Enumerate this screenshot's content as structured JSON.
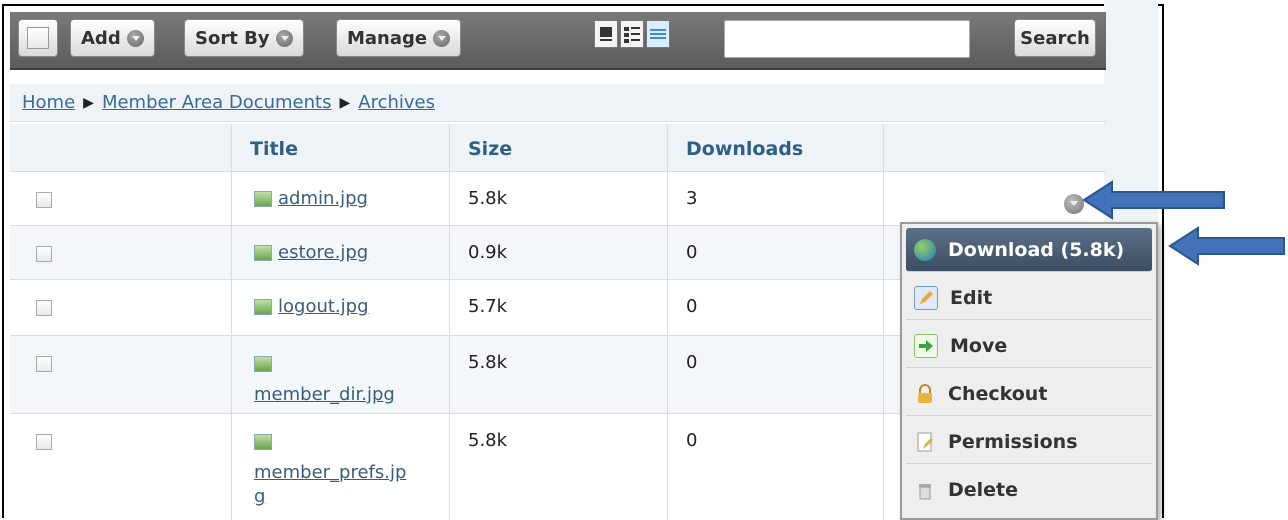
{
  "toolbar": {
    "add_label": "Add",
    "sort_label": "Sort By",
    "manage_label": "Manage",
    "search_label": "Search",
    "search_value": ""
  },
  "breadcrumb": {
    "items": [
      "Home",
      "Member Area Documents",
      "Archives"
    ],
    "separator": "▶"
  },
  "table": {
    "columns": [
      "Title",
      "Size",
      "Downloads"
    ],
    "rows": [
      {
        "title": "admin.jpg",
        "size": "5.8k",
        "downloads": "3"
      },
      {
        "title": "estore.jpg",
        "size": "0.9k",
        "downloads": "0"
      },
      {
        "title": "logout.jpg",
        "size": "5.7k",
        "downloads": "0"
      },
      {
        "title": "member_dir.jpg",
        "size": "5.8k",
        "downloads": "0"
      },
      {
        "title_line1": "member_prefs.jp",
        "title_line2": "g",
        "size": "5.8k",
        "downloads": "0"
      }
    ]
  },
  "menu": {
    "items": [
      "Download (5.8k)",
      "Edit",
      "Move",
      "Checkout",
      "Permissions",
      "Delete"
    ]
  },
  "colors": {
    "accent": "#2e5f86",
    "arrow": "#3d6fb5",
    "menu_active": "#4a5c72"
  },
  "icons": [
    "checkbox-icon",
    "dropdown-circle-icon",
    "list-view-icon",
    "detail-view-icon",
    "table-view-icon",
    "image-file-icon",
    "globe-icon",
    "pencil-icon",
    "move-arrow-icon",
    "lock-icon",
    "permissions-icon",
    "trash-icon",
    "callout-arrow-icon"
  ]
}
